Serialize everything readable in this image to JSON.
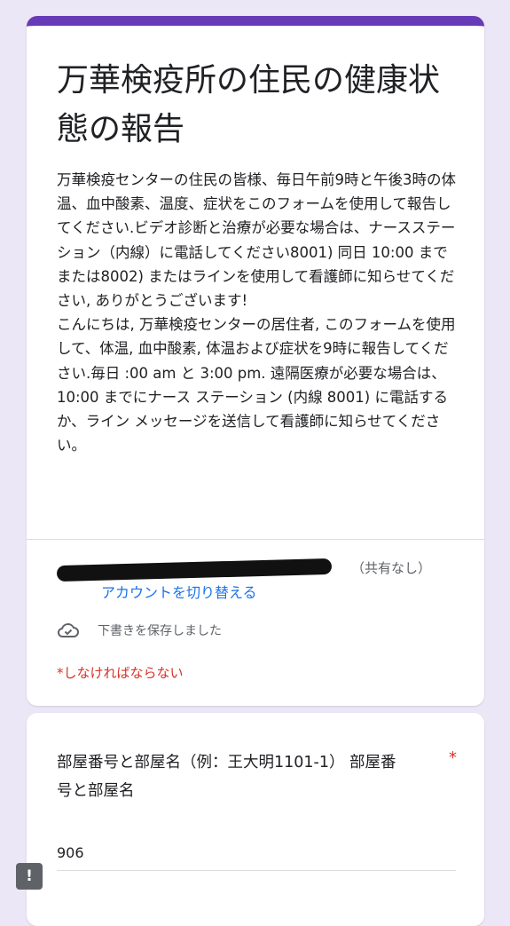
{
  "form": {
    "title": "万華検疫所の住民の健康状態の報告",
    "description": "万華検疫センターの住民の皆様、毎日午前9時と午後3時の体温、血中酸素、温度、症状をこのフォームを使用して報告してください.ビデオ診断と治療が必要な場合は、ナースステーション（内線）に電話してください8001) 同日 10:00 までまたは8002) またはラインを使用して看護師に知らせてください, ありがとうございます!\nこんにちは, 万華検疫センターの居住者, このフォームを使用して、体温, 血中酸素, 体温および症状を9時に報告してください.毎日 :00 am と 3:00 pm. 遠隔医療が必要な場合は、10:00 までにナース ステーション (内線 8001) に電話するか、ライン メッセージを送信して看護師に知らせてください。",
    "account": {
      "not_shared": "（共有なし）",
      "switch_account": "アカウントを切り替える"
    },
    "draft_saved": "下書きを保存しました",
    "required_note": "*しなければならない"
  },
  "question": {
    "label": "部屋番号と部屋名（例：王大明1101-1） 部屋番号と部屋名",
    "required_mark": "*",
    "answer": "906"
  },
  "feedback": {
    "label": "!"
  },
  "colors": {
    "accent": "#673ab7",
    "background": "#ece7f6",
    "link": "#1a73e8",
    "required": "#d93025"
  },
  "icons": {
    "draft": "cloud-check-icon",
    "feedback": "feedback-icon"
  }
}
